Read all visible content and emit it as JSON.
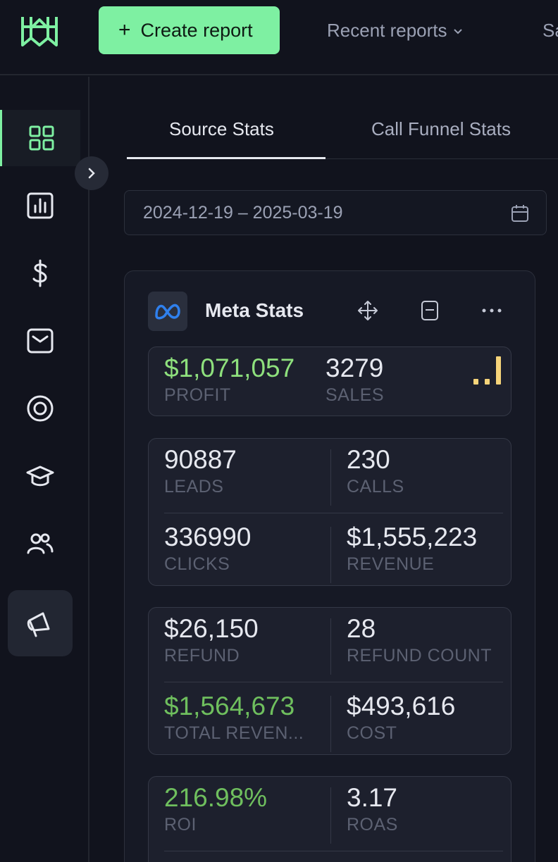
{
  "header": {
    "create_label": "Create report",
    "recent_label": "Recent reports",
    "next_nav_partial": "Sa"
  },
  "sidebar": {
    "items": [
      "dashboard-icon",
      "chart-icon",
      "dollar-icon",
      "mail-icon",
      "target-icon",
      "graduation-icon",
      "users-icon",
      "megaphone-icon"
    ],
    "active": "dashboard-icon"
  },
  "tabs": [
    {
      "label": "Source Stats",
      "active": true
    },
    {
      "label": "Call Funnel Stats",
      "active": false
    }
  ],
  "date_range": "2024-12-19 – 2025-03-19",
  "card": {
    "title": "Meta Stats",
    "summary": {
      "profit_value": "$1,071,057",
      "profit_label": "PROFIT",
      "sales_value": "3279",
      "sales_label": "SALES",
      "signal_level": 0.3
    },
    "group1": {
      "leads_value": "90887",
      "leads_label": "LEADS",
      "calls_value": "230",
      "calls_label": "CALLS",
      "clicks_value": "336990",
      "clicks_label": "CLICKS",
      "revenue_value": "$1,555,223",
      "revenue_label": "REVENUE"
    },
    "group2": {
      "refund_value": "$26,150",
      "refund_label": "REFUND",
      "refund_count_value": "28",
      "refund_count_label": "REFUND COUNT",
      "total_revenue_value": "$1,564,673",
      "total_revenue_label": "TOTAL REVEN...",
      "cost_value": "$493,616",
      "cost_label": "COST"
    },
    "group3": {
      "roi_value": "216.98%",
      "roi_label": "ROI",
      "roas_value": "3.17",
      "roas_label": "ROAS"
    }
  },
  "colors": {
    "accent": "#7ef0a2",
    "positive": "#8ee07d",
    "signal": "#f6d47a",
    "background": "#11131d"
  }
}
